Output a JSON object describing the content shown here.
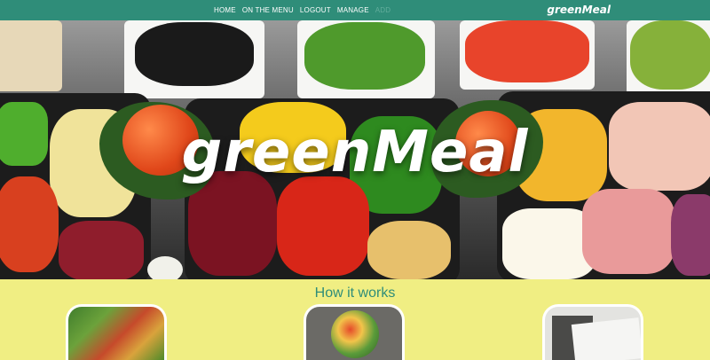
{
  "navbar": {
    "links": [
      "HOME",
      "ON THE MENU",
      "LOGOUT",
      "MANAGE",
      "ADD"
    ],
    "brand": "greenMeal",
    "background": "#2f8d79"
  },
  "hero": {
    "title": "greenMeal"
  },
  "section": {
    "title": "How it works",
    "title_color": "#2f8d79",
    "background": "#f0ee83",
    "cards": [
      {
        "icon": "vegetables-image"
      },
      {
        "icon": "salad-bowl-image"
      },
      {
        "icon": "calendar-image"
      }
    ]
  }
}
